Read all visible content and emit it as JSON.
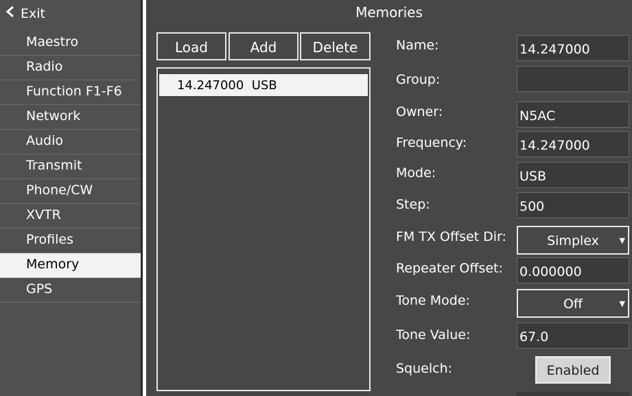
{
  "sidebar": {
    "exit_label": "Exit",
    "items": [
      {
        "label": "Maestro"
      },
      {
        "label": "Radio"
      },
      {
        "label": "Function F1-F6"
      },
      {
        "label": "Network"
      },
      {
        "label": "Audio"
      },
      {
        "label": "Transmit"
      },
      {
        "label": "Phone/CW"
      },
      {
        "label": "XVTR"
      },
      {
        "label": "Profiles"
      },
      {
        "label": "Memory",
        "active": true
      },
      {
        "label": "GPS"
      }
    ]
  },
  "main": {
    "title": "Memories",
    "buttons": {
      "load": "Load",
      "add": "Add",
      "delete": "Delete"
    },
    "list": [
      {
        "text": "14.247000  USB",
        "selected": true
      }
    ],
    "fields": {
      "name": {
        "label": "Name:",
        "value": "14.247000"
      },
      "group": {
        "label": "Group:",
        "value": ""
      },
      "owner": {
        "label": "Owner:",
        "value": "N5AC"
      },
      "frequency": {
        "label": "Frequency:",
        "value": "14.247000"
      },
      "mode": {
        "label": "Mode:",
        "value": "USB"
      },
      "step": {
        "label": "Step:",
        "value": "500"
      },
      "fm_tx_offset_dir": {
        "label": "FM TX Offset Dir:",
        "value": "Simplex"
      },
      "repeater_offset": {
        "label": "Repeater Offset:",
        "value": "0.000000"
      },
      "tone_mode": {
        "label": "Tone Mode:",
        "value": "Off"
      },
      "tone_value": {
        "label": "Tone Value:",
        "value": "67.0"
      },
      "squelch": {
        "label": "Squelch:",
        "button": "Enabled"
      }
    }
  }
}
